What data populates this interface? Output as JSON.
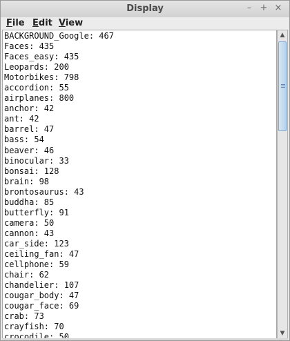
{
  "window": {
    "title": "Display",
    "controls": {
      "minimize": "–",
      "maximize": "+",
      "close": "×"
    }
  },
  "menubar": {
    "items": [
      {
        "label_mnemonic": "F",
        "label_rest": "ile"
      },
      {
        "label_mnemonic": "E",
        "label_rest": "dit"
      },
      {
        "label_mnemonic": "V",
        "label_rest": "iew"
      }
    ]
  },
  "content": {
    "lines": [
      "BACKGROUND_Google: 467",
      "Faces: 435",
      "Faces_easy: 435",
      "Leopards: 200",
      "Motorbikes: 798",
      "accordion: 55",
      "airplanes: 800",
      "anchor: 42",
      "ant: 42",
      "barrel: 47",
      "bass: 54",
      "beaver: 46",
      "binocular: 33",
      "bonsai: 128",
      "brain: 98",
      "brontosaurus: 43",
      "buddha: 85",
      "butterfly: 91",
      "camera: 50",
      "cannon: 43",
      "car_side: 123",
      "ceiling_fan: 47",
      "cellphone: 59",
      "chair: 62",
      "chandelier: 107",
      "cougar_body: 47",
      "cougar_face: 69",
      "crab: 73",
      "crayfish: 70",
      "crocodile: 50"
    ]
  },
  "scrollbar": {
    "up_icon": "scroll-up-arrow-icon",
    "down_icon": "scroll-down-arrow-icon"
  }
}
